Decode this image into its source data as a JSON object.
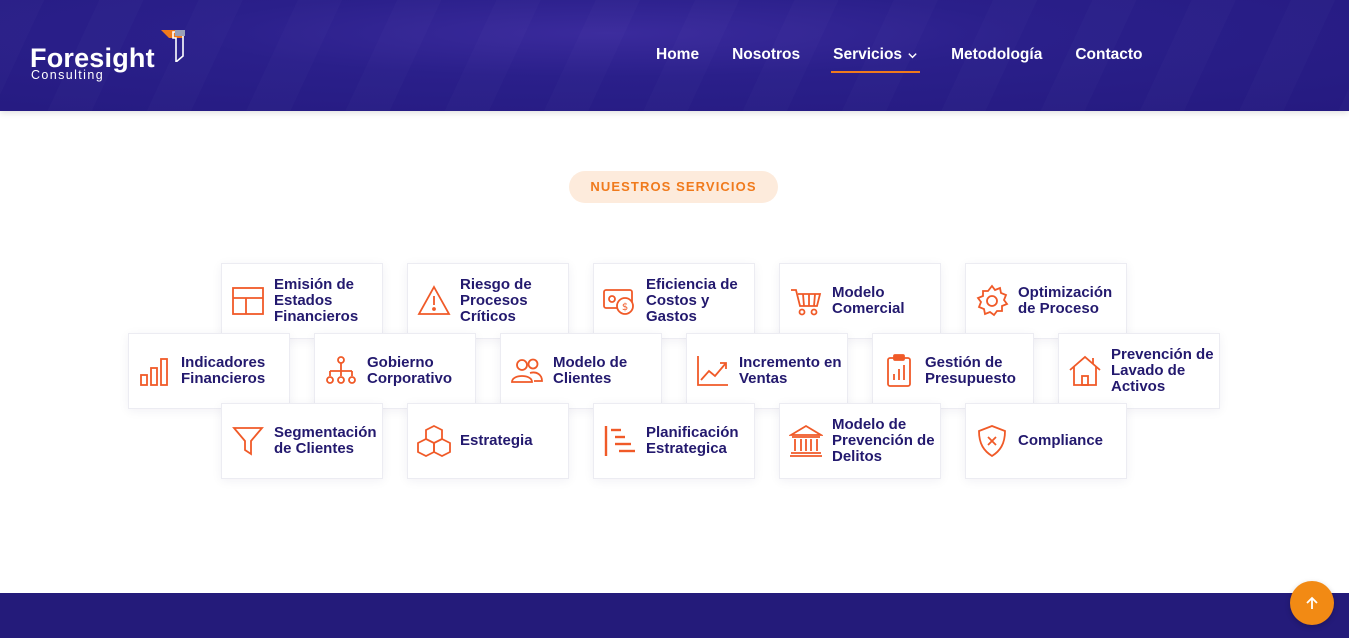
{
  "brand": {
    "name": "Foresight",
    "tagline": "Consulting"
  },
  "nav": {
    "items": [
      {
        "label": "Home"
      },
      {
        "label": "Nosotros"
      },
      {
        "label": "Servicios",
        "active": true,
        "icon": "chevron-down-icon"
      },
      {
        "label": "Metodología"
      },
      {
        "label": "Contacto"
      }
    ]
  },
  "section": {
    "badge": "NUESTROS SERVICIOS"
  },
  "services": [
    {
      "label": "Emisión de Estados Financieros",
      "icon": "table-layout-icon"
    },
    {
      "label": "Riesgo de Procesos Críticos",
      "icon": "warning-icon"
    },
    {
      "label": "Eficiencia de Costos y Gastos",
      "icon": "money-icon"
    },
    {
      "label": "Modelo Comercial",
      "icon": "shopping-cart-icon"
    },
    {
      "label": "Optimización de Proceso",
      "icon": "gear-icon"
    },
    {
      "label": "Indicadores Financieros",
      "icon": "bar-chart-icon"
    },
    {
      "label": "Gobierno Corporativo",
      "icon": "org-chart-icon"
    },
    {
      "label": "Modelo de Clientes",
      "icon": "users-icon"
    },
    {
      "label": "Incremento en Ventas",
      "icon": "trend-up-icon"
    },
    {
      "label": "Gestión de Presupuesto",
      "icon": "clipboard-chart-icon"
    },
    {
      "label": "Prevención de Lavado de Activos",
      "icon": "home-icon"
    },
    {
      "label": "Segmentación de Clientes",
      "icon": "funnel-icon"
    },
    {
      "label": "Estrategia",
      "icon": "cubes-icon"
    },
    {
      "label": "Planificación Estrategica",
      "icon": "gantt-icon"
    },
    {
      "label": "Modelo de Prevención de Delitos",
      "icon": "bank-icon"
    },
    {
      "label": "Compliance",
      "icon": "shield-x-icon"
    }
  ],
  "scroll_top": {
    "icon": "arrow-up-icon"
  },
  "colors": {
    "header": "#2a1f8a",
    "accent": "#f07a1c",
    "text": "#23196e",
    "badge_bg": "#fdebdc"
  }
}
